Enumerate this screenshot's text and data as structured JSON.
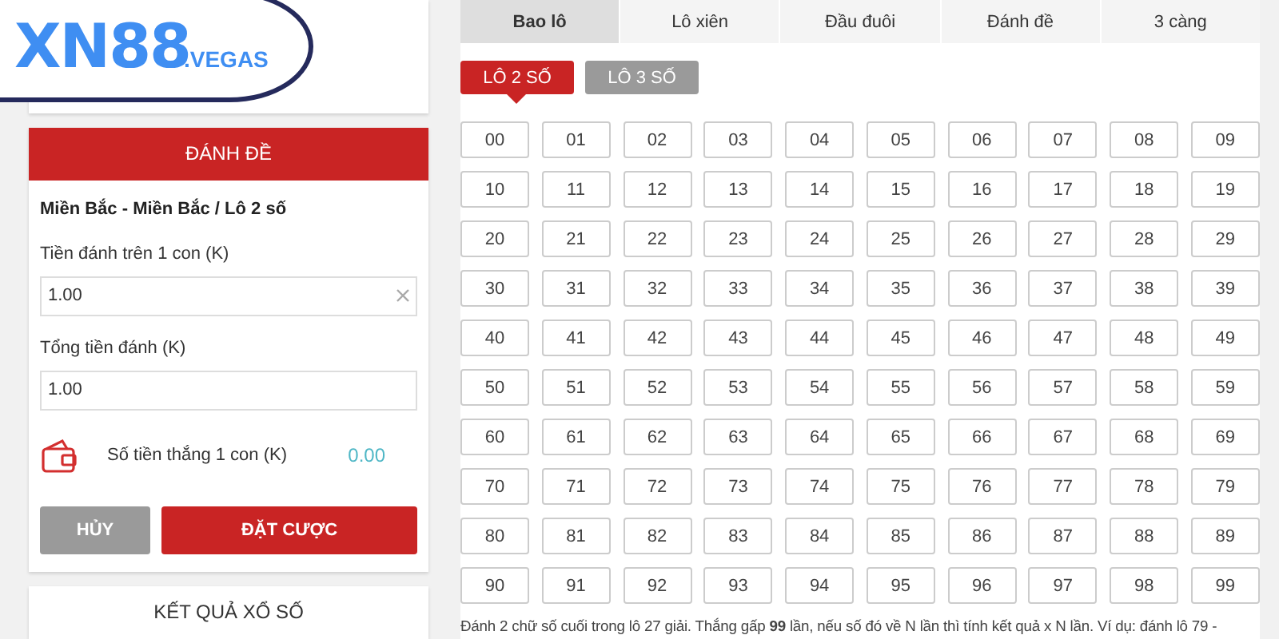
{
  "logo": {
    "main": "XN88",
    "suffix": ".VEGAS"
  },
  "bet_panel": {
    "header": "ĐÁNH ĐỀ",
    "subtitle": "Miền Bắc - Miền Bắc / Lô 2 số",
    "fields": [
      {
        "label": "Tiền đánh trên 1 con (K)",
        "value": "1.00",
        "clearable": true
      },
      {
        "label": "Tổng tiền đánh (K)",
        "value": "1.00",
        "clearable": false
      }
    ],
    "win": {
      "label": "Số tiền thắng 1 con (K)",
      "value": "0.00"
    },
    "buttons": [
      {
        "label": "HỦY",
        "kind": "cancel"
      },
      {
        "label": "ĐẶT CƯỢC",
        "kind": "submit"
      }
    ]
  },
  "results_link": "KẾT QUẢ XỔ SỐ",
  "tabs": [
    {
      "label": "Bao lô",
      "selected": true
    },
    {
      "label": "Lô xiên",
      "selected": false
    },
    {
      "label": "Đầu đuôi",
      "selected": false
    },
    {
      "label": "Đánh đề",
      "selected": false
    },
    {
      "label": "3 càng",
      "selected": false
    }
  ],
  "subtabs": [
    {
      "label": "LÔ 2 SỐ",
      "selected": true
    },
    {
      "label": "LÔ 3 SỐ",
      "selected": false
    }
  ],
  "numbers": [
    {
      "label": "00",
      "selected": false
    },
    {
      "label": "01",
      "selected": false
    },
    {
      "label": "02",
      "selected": false
    },
    {
      "label": "03",
      "selected": false
    },
    {
      "label": "04",
      "selected": false
    },
    {
      "label": "05",
      "selected": false
    },
    {
      "label": "06",
      "selected": false
    },
    {
      "label": "07",
      "selected": false
    },
    {
      "label": "08",
      "selected": false
    },
    {
      "label": "09",
      "selected": false
    },
    {
      "label": "10",
      "selected": false
    },
    {
      "label": "11",
      "selected": false
    },
    {
      "label": "12",
      "selected": false
    },
    {
      "label": "13",
      "selected": false
    },
    {
      "label": "14",
      "selected": false
    },
    {
      "label": "15",
      "selected": false
    },
    {
      "label": "16",
      "selected": false
    },
    {
      "label": "17",
      "selected": false
    },
    {
      "label": "18",
      "selected": false
    },
    {
      "label": "19",
      "selected": false
    },
    {
      "label": "20",
      "selected": false
    },
    {
      "label": "21",
      "selected": false
    },
    {
      "label": "22",
      "selected": false
    },
    {
      "label": "23",
      "selected": false
    },
    {
      "label": "24",
      "selected": false
    },
    {
      "label": "25",
      "selected": false
    },
    {
      "label": "26",
      "selected": false
    },
    {
      "label": "27",
      "selected": false
    },
    {
      "label": "28",
      "selected": false
    },
    {
      "label": "29",
      "selected": false
    },
    {
      "label": "30",
      "selected": false
    },
    {
      "label": "31",
      "selected": false
    },
    {
      "label": "32",
      "selected": false
    },
    {
      "label": "33",
      "selected": false
    },
    {
      "label": "34",
      "selected": false
    },
    {
      "label": "35",
      "selected": false
    },
    {
      "label": "36",
      "selected": false
    },
    {
      "label": "37",
      "selected": false
    },
    {
      "label": "38",
      "selected": false
    },
    {
      "label": "39",
      "selected": false
    },
    {
      "label": "40",
      "selected": false
    },
    {
      "label": "41",
      "selected": false
    },
    {
      "label": "42",
      "selected": false
    },
    {
      "label": "43",
      "selected": false
    },
    {
      "label": "44",
      "selected": false
    },
    {
      "label": "45",
      "selected": false
    },
    {
      "label": "46",
      "selected": false
    },
    {
      "label": "47",
      "selected": false
    },
    {
      "label": "48",
      "selected": false
    },
    {
      "label": "49",
      "selected": false
    },
    {
      "label": "50",
      "selected": false
    },
    {
      "label": "51",
      "selected": false
    },
    {
      "label": "52",
      "selected": false
    },
    {
      "label": "53",
      "selected": false
    },
    {
      "label": "54",
      "selected": false
    },
    {
      "label": "55",
      "selected": false
    },
    {
      "label": "56",
      "selected": false
    },
    {
      "label": "57",
      "selected": false
    },
    {
      "label": "58",
      "selected": false
    },
    {
      "label": "59",
      "selected": false
    },
    {
      "label": "60",
      "selected": false
    },
    {
      "label": "61",
      "selected": false
    },
    {
      "label": "62",
      "selected": false
    },
    {
      "label": "63",
      "selected": false
    },
    {
      "label": "64",
      "selected": false
    },
    {
      "label": "65",
      "selected": false
    },
    {
      "label": "66",
      "selected": false
    },
    {
      "label": "67",
      "selected": false
    },
    {
      "label": "68",
      "selected": false
    },
    {
      "label": "69",
      "selected": false
    },
    {
      "label": "70",
      "selected": false
    },
    {
      "label": "71",
      "selected": false
    },
    {
      "label": "72",
      "selected": false
    },
    {
      "label": "73",
      "selected": false
    },
    {
      "label": "74",
      "selected": false
    },
    {
      "label": "75",
      "selected": false
    },
    {
      "label": "76",
      "selected": false
    },
    {
      "label": "77",
      "selected": false
    },
    {
      "label": "78",
      "selected": false
    },
    {
      "label": "79",
      "selected": false
    },
    {
      "label": "80",
      "selected": false
    },
    {
      "label": "81",
      "selected": false
    },
    {
      "label": "82",
      "selected": false
    },
    {
      "label": "83",
      "selected": false
    },
    {
      "label": "84",
      "selected": false
    },
    {
      "label": "85",
      "selected": false
    },
    {
      "label": "86",
      "selected": false
    },
    {
      "label": "87",
      "selected": false
    },
    {
      "label": "88",
      "selected": false
    },
    {
      "label": "89",
      "selected": false
    },
    {
      "label": "90",
      "selected": false
    },
    {
      "label": "91",
      "selected": false
    },
    {
      "label": "92",
      "selected": false
    },
    {
      "label": "93",
      "selected": false
    },
    {
      "label": "94",
      "selected": false
    },
    {
      "label": "95",
      "selected": false
    },
    {
      "label": "96",
      "selected": false
    },
    {
      "label": "97",
      "selected": false
    },
    {
      "label": "98",
      "selected": false
    },
    {
      "label": "99",
      "selected": false
    }
  ],
  "description": "Đánh 2 chữ số cuối trong lô 27 giải. Thắng gấp **99** lần, nếu số đó về N lần thì tính kết quả x N lần. Ví dụ: đánh lô 79 -"
}
